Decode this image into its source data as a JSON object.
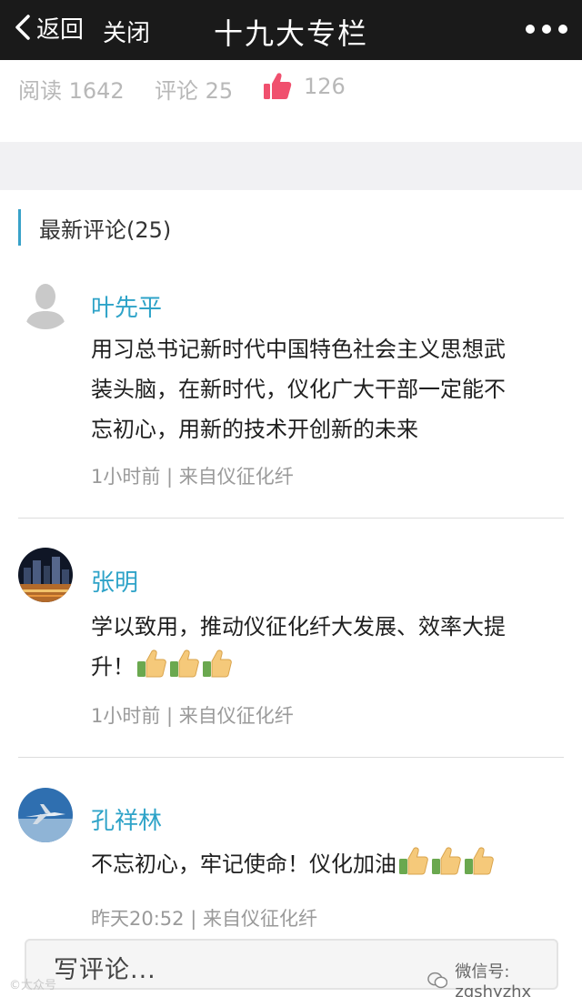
{
  "nav": {
    "back_label": "返回",
    "close_label": "关闭",
    "title": "十九大专栏"
  },
  "stats": {
    "read": "阅读 1642",
    "comments": "评论 25",
    "likes": "126",
    "like_color": "#f0506e"
  },
  "section": {
    "title": "最新评论(25)",
    "accent": "#38a1c8"
  },
  "comments": [
    {
      "name": "叶先平",
      "avatar": "default-user-avatar",
      "text_lines": [
        "用习总书记新时代中国特色社会主义思想武",
        "装头脑，在新时代，仪化广大干部一定能不",
        "忘初心，用新的技术开创新的未来"
      ],
      "meta": "1小时前 | 来自仪征化纤"
    },
    {
      "name": "张明",
      "avatar": "city-night-avatar",
      "text_lines": [
        "学以致用，推动仪征化纤大发展、效率大提",
        "升！"
      ],
      "emoji": "thumbs-up-icon",
      "emoji_count": 3,
      "meta": "1小时前 | 来自仪征化纤"
    },
    {
      "name": "孔祥林",
      "avatar": "jet-plane-avatar",
      "text_lines": [
        "不忘初心，牢记使命！仪化加油"
      ],
      "emoji": "thumbs-up-icon",
      "emoji_count": 3,
      "meta": "昨天20:52 | 来自仪征化纤"
    }
  ],
  "composer": {
    "placeholder": "写评论..."
  },
  "watermark": {
    "right": "微信号: zgshyzhx",
    "left": "©大众号"
  },
  "colors": {
    "name": "#2ea3c8",
    "topbar": "#1a1a1a"
  }
}
